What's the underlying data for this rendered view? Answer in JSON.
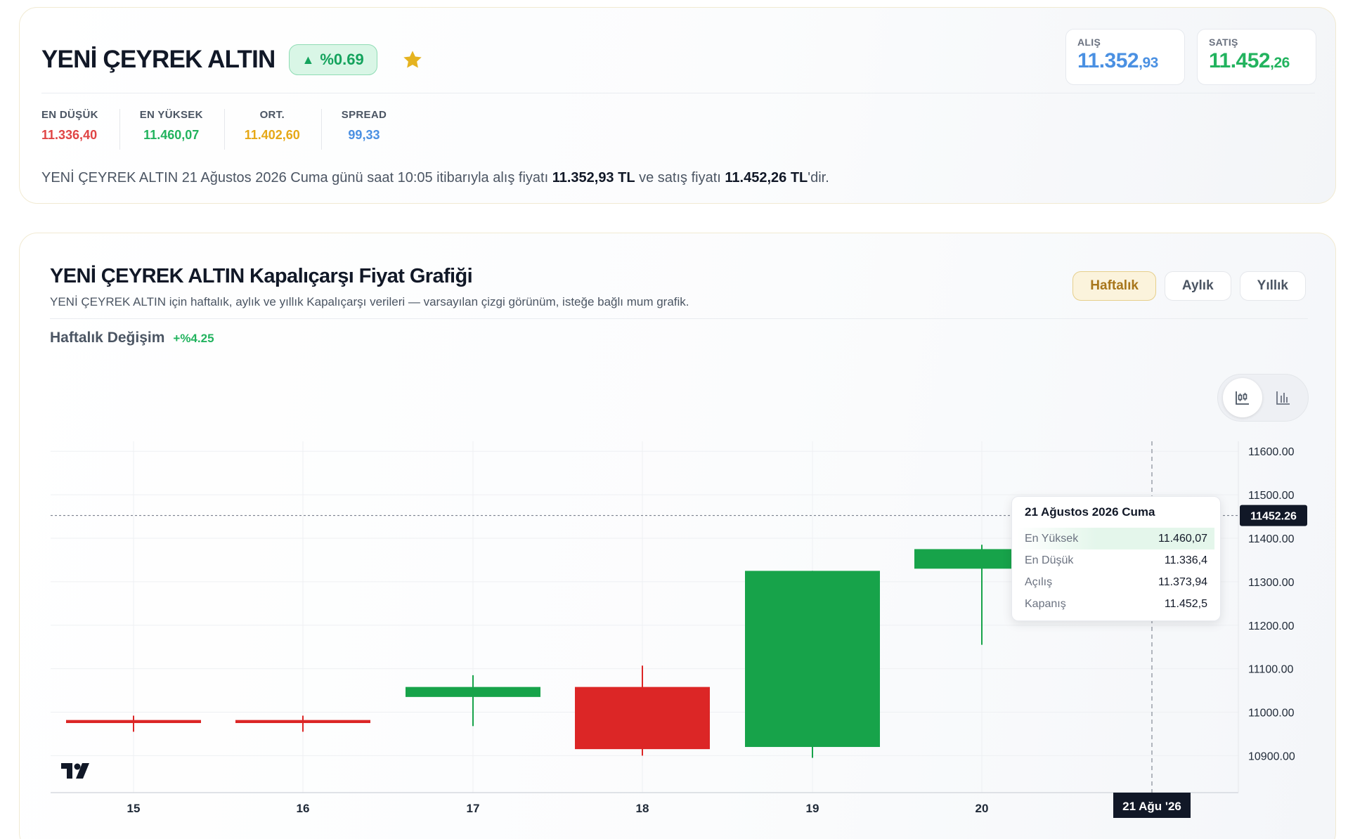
{
  "header": {
    "title": "YENİ ÇEYREK ALTIN",
    "change": "%0.69",
    "change_arrow": "▲",
    "buy_label": "ALIŞ",
    "buy_int": "11.352",
    "buy_dec": ",93",
    "sell_label": "SATIŞ",
    "sell_int": "11.452",
    "sell_dec": ",26"
  },
  "stats": [
    {
      "label": "EN DÜŞÜK",
      "value": "11.336,40",
      "color": "#e04545"
    },
    {
      "label": "EN YÜKSEK",
      "value": "11.460,07",
      "color": "#22b35e"
    },
    {
      "label": "ORT.",
      "value": "11.402,60",
      "color": "#e6a817"
    },
    {
      "label": "SPREAD",
      "value": "99,33",
      "color": "#4a90e2"
    }
  ],
  "summary": {
    "part1": "YENİ ÇEYREK ALTIN 21 Ağustos 2026 Cuma günü saat 10:05 itibarıyla alış fiyatı ",
    "buy": "11.352,93 TL",
    "part2": " ve satış fiyatı ",
    "sell": "11.452,26 TL",
    "part3": "'dir."
  },
  "chart_section": {
    "title": "YENİ ÇEYREK ALTIN Kapalıçarşı Fiyat Grafiği",
    "subtitle": "YENİ ÇEYREK ALTIN için haftalık, aylık ve yıllık Kapalıçarşı verileri — varsayılan çizgi görünüm, isteğe bağlı mum grafik.",
    "tabs": [
      "Haftalık",
      "Aylık",
      "Yıllık"
    ],
    "active_tab": "Haftalık",
    "weekly_change_label": "Haftalık Değişim",
    "weekly_change_value": "+%4.25",
    "chart_type_icons": [
      "candlestick-icon",
      "bar-chart-icon"
    ]
  },
  "tooltip": {
    "date": "21 Ağustos 2026 Cuma",
    "rows": [
      {
        "label": "En Yüksek",
        "value": "11.460,07"
      },
      {
        "label": "En Düşük",
        "value": "11.336,4"
      },
      {
        "label": "Açılış",
        "value": "11.373,94"
      },
      {
        "label": "Kapanış",
        "value": "11.452,5"
      }
    ]
  },
  "chart_data": {
    "type": "candlestick",
    "x": [
      "15",
      "16",
      "17",
      "18",
      "19",
      "20",
      "21 Ağu '26"
    ],
    "y_ticks": [
      "11600.00",
      "11500.00",
      "11400.00",
      "11300.00",
      "11200.00",
      "11100.00",
      "11000.00",
      "10900.00"
    ],
    "ylim": [
      10815,
      11623
    ],
    "current_price": 11452.26,
    "current_price_label": "11452.26",
    "crosshair_label": "21 Ağu '26",
    "candles": [
      {
        "x": "15",
        "open": 10982,
        "close": 10975,
        "high": 10992,
        "low": 10955
      },
      {
        "x": "16",
        "open": 10982,
        "close": 10975,
        "high": 10992,
        "low": 10955
      },
      {
        "x": "17",
        "open": 11035,
        "close": 11058,
        "high": 11085,
        "low": 10968
      },
      {
        "x": "18",
        "open": 11058,
        "close": 10915,
        "high": 11107,
        "low": 10900
      },
      {
        "x": "19",
        "open": 10920,
        "close": 11325,
        "high": 11325,
        "low": 10895
      },
      {
        "x": "20",
        "open": 11330,
        "close": 11375,
        "high": 11385,
        "low": 11155
      }
    ],
    "colors": {
      "up": "#17a34a",
      "down": "#dc2626"
    },
    "grid": true
  }
}
